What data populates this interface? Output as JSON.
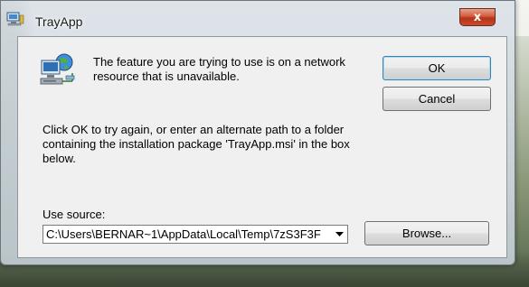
{
  "window": {
    "title": "TrayApp",
    "close_glyph": "x"
  },
  "dialog": {
    "message": "The feature you are trying to use is on a network resource that is unavailable.",
    "instructions": "Click OK to try again, or enter an alternate path to a folder containing the installation package 'TrayApp.msi' in the box below.",
    "use_source_label": "Use source:",
    "source_path": "C:\\Users\\BERNAR~1\\AppData\\Local\\Temp\\7zS3F3F",
    "buttons": {
      "ok": "OK",
      "cancel": "Cancel",
      "browse": "Browse..."
    }
  },
  "icons": {
    "title": "installer-computer-icon",
    "message": "network-computer-icon",
    "combo_arrow": "dropdown-arrow-icon",
    "close": "close-icon"
  },
  "colors": {
    "close_button": "#c94a2c",
    "default_button_border": "#3c7fb1",
    "client_background": "#f0f0f0"
  }
}
